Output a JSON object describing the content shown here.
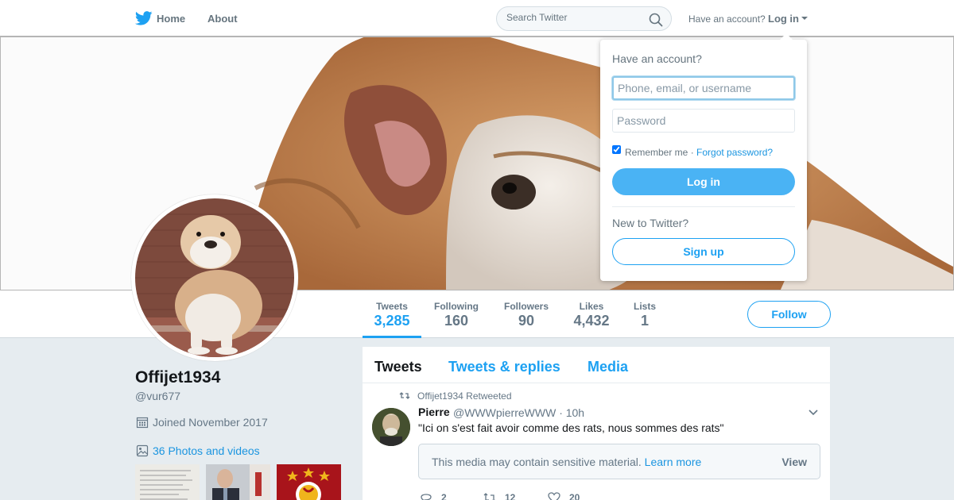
{
  "nav": {
    "home": "Home",
    "about": "About",
    "search_placeholder": "Search Twitter",
    "have_account": "Have an account?",
    "login": "Log in"
  },
  "profile": {
    "name": "Offijet1934",
    "handle": "@vur677",
    "joined": "Joined November 2017",
    "photos_link": "36 Photos and videos",
    "follow": "Follow",
    "stats": [
      {
        "label": "Tweets",
        "value": "3,285"
      },
      {
        "label": "Following",
        "value": "160"
      },
      {
        "label": "Followers",
        "value": "90"
      },
      {
        "label": "Likes",
        "value": "4,432"
      },
      {
        "label": "Lists",
        "value": "1"
      }
    ]
  },
  "timeline": {
    "tabs": [
      "Tweets",
      "Tweets & replies",
      "Media"
    ],
    "tweet": {
      "retweet_context": "Offijet1934 Retweeted",
      "author": "Pierre",
      "handle": "@WWWpierreWWW",
      "time": "· 10h",
      "text": "\"Ici on s'est fait avoir comme des rats, nous sommes des rats\"",
      "sensitive_msg": "This media may contain sensitive material.",
      "learn_more": "Learn more",
      "view": "View",
      "replies": "2",
      "retweets": "12",
      "likes": "20"
    }
  },
  "login_dropdown": {
    "title": "Have an account?",
    "username_placeholder": "Phone, email, or username",
    "password_placeholder": "Password",
    "remember": "Remember me",
    "separator": " · ",
    "forgot": "Forgot password?",
    "login_button": "Log in",
    "new_to": "New to Twitter?",
    "signup_button": "Sign up"
  },
  "colors": {
    "accent": "#1da1f2",
    "link": "#1b95e0",
    "muted": "#657786",
    "background": "#e6ecf0"
  },
  "icons": [
    "twitter-bird-icon",
    "search-icon",
    "calendar-icon",
    "image-icon",
    "retweet-icon",
    "chevron-down-icon",
    "reply-icon",
    "like-icon"
  ]
}
